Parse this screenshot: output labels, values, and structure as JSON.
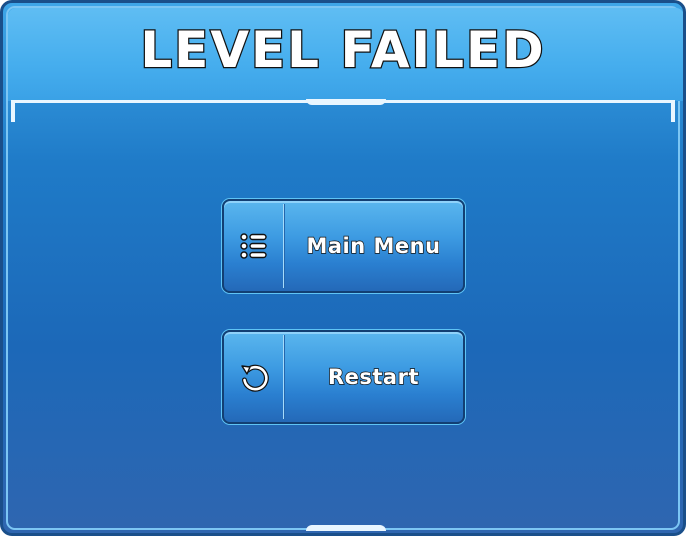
{
  "dialog": {
    "title": "LEVEL FAILED"
  },
  "buttons": {
    "main_menu": {
      "label": "Main Menu",
      "icon": "list-icon"
    },
    "restart": {
      "label": "Restart",
      "icon": "restart-icon"
    }
  },
  "colors": {
    "panel_top": "#3ea6e8",
    "panel_bottom": "#2f66b0",
    "header": "#5fbdf3",
    "button": "#3d9be2",
    "text": "#ffffff",
    "outline": "#111111"
  }
}
